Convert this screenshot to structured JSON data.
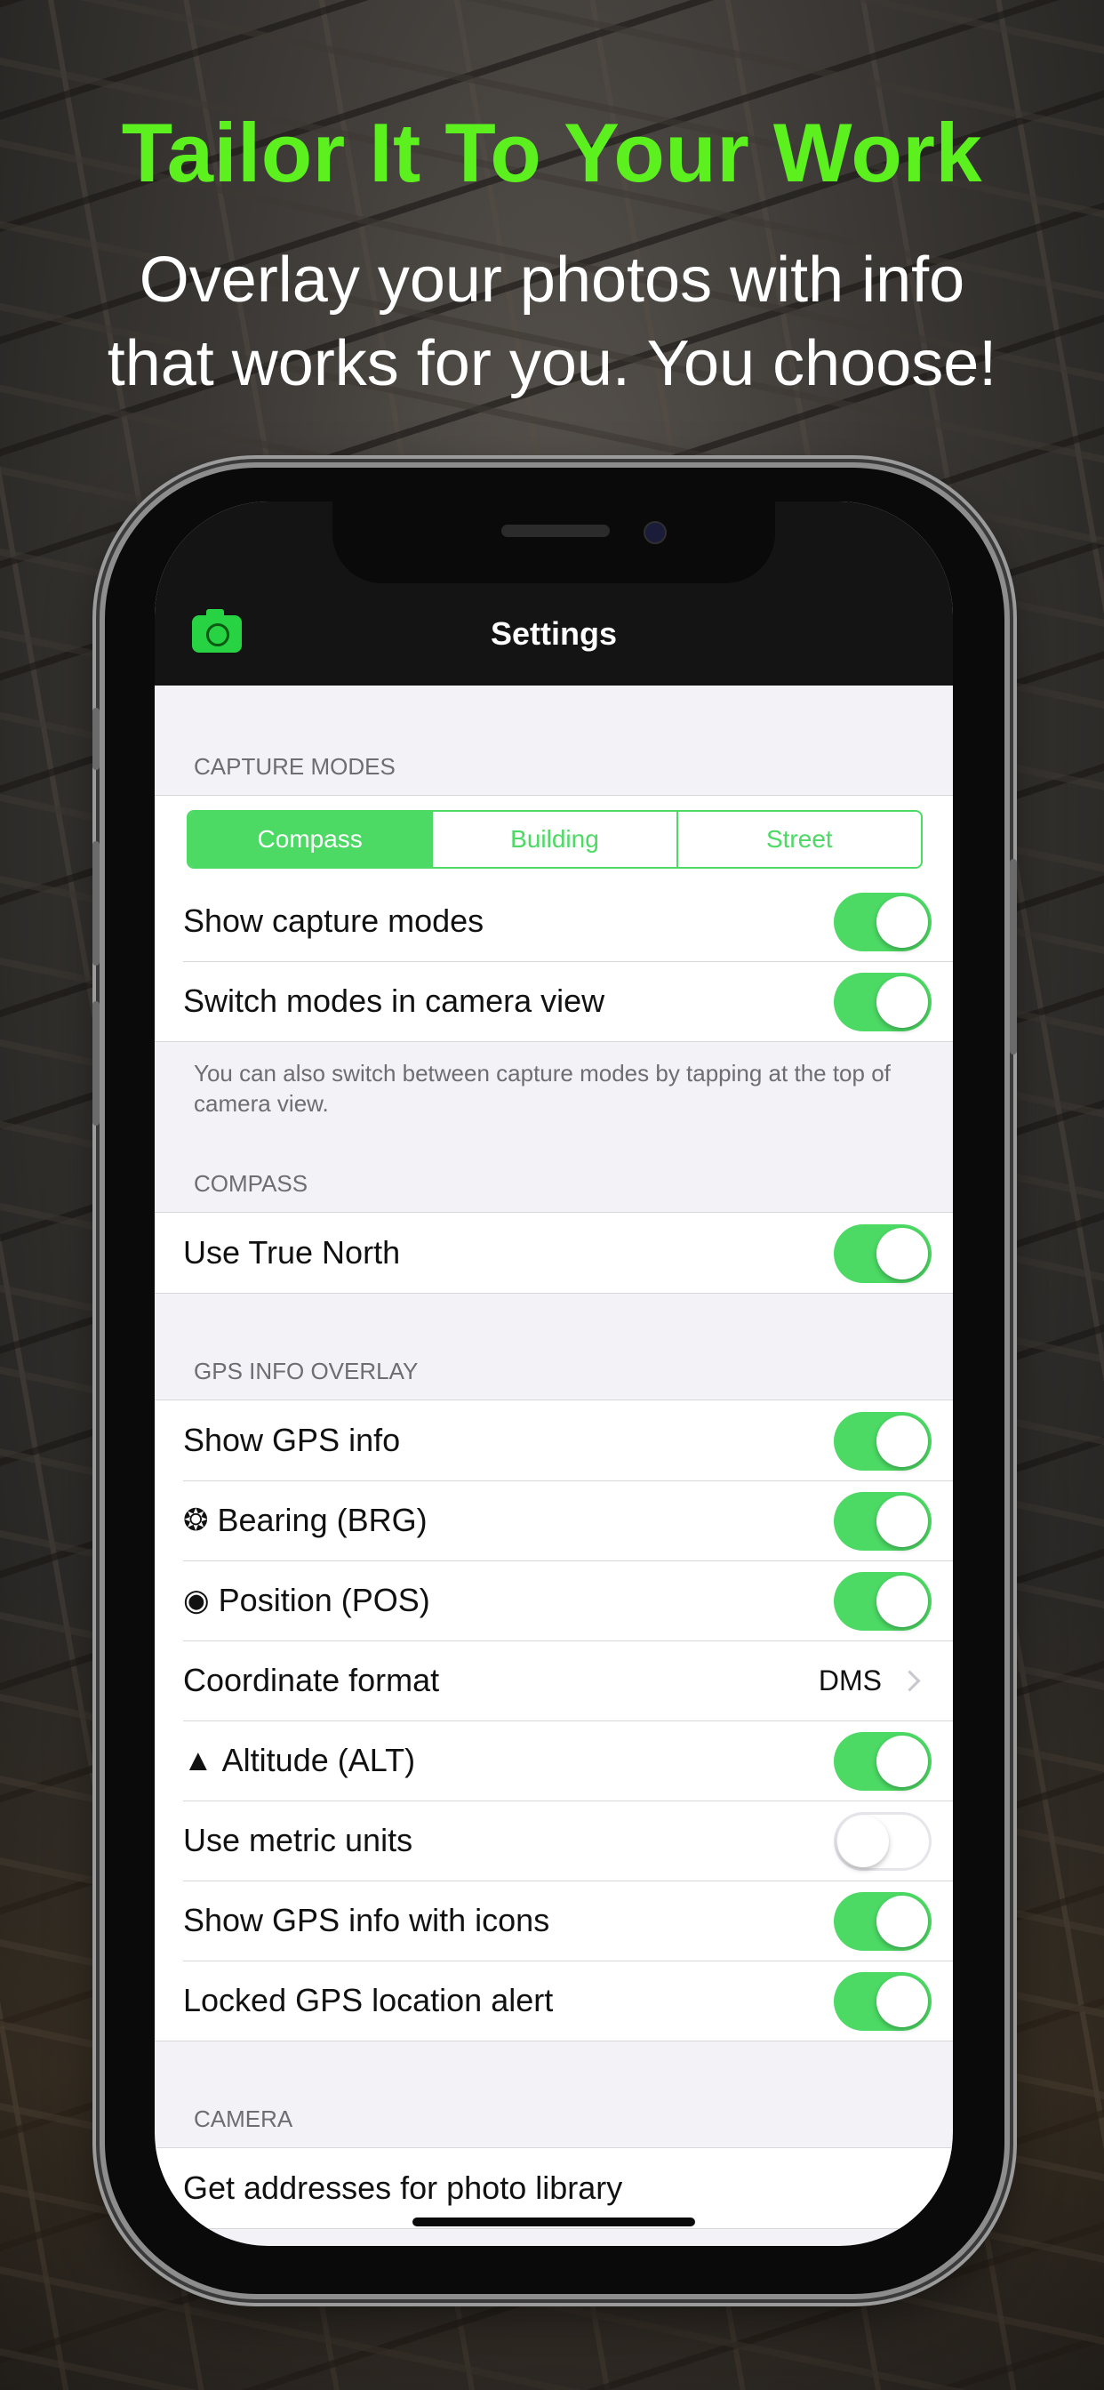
{
  "promo": {
    "headline": "Tailor It To Your Work",
    "subhead_line1": "Overlay your photos with info",
    "subhead_line2": "that works for you. You choose!"
  },
  "colors": {
    "accent_green": "#5df01f",
    "ios_green": "#4cd964",
    "nav_bg": "#141414"
  },
  "navbar": {
    "title": "Settings",
    "left_icon": "camera-icon"
  },
  "capture_modes": {
    "header": "CAPTURE MODES",
    "segments": [
      "Compass",
      "Building",
      "Street"
    ],
    "selected": "Compass",
    "rows": [
      {
        "label": "Show capture modes",
        "on": true
      },
      {
        "label": "Switch modes in camera view",
        "on": true
      }
    ],
    "footer": "You can also switch between capture modes by tapping at the top of camera view."
  },
  "compass": {
    "header": "COMPASS",
    "rows": [
      {
        "label": "Use True North",
        "on": true
      }
    ]
  },
  "gps": {
    "header": "GPS INFO OVERLAY",
    "rows": [
      {
        "label": "Show GPS info",
        "on": true
      },
      {
        "icon": "❂",
        "label": "Bearing (BRG)",
        "on": true
      },
      {
        "icon": "◉",
        "label": "Position (POS)",
        "on": true
      },
      {
        "label": "Coordinate format",
        "detail": "DMS"
      },
      {
        "icon": "▲",
        "label": "Altitude (ALT)",
        "on": true
      },
      {
        "label": "Use metric units",
        "on": false
      },
      {
        "label": "Show GPS info with icons",
        "on": true
      },
      {
        "label": "Locked GPS location alert",
        "on": true
      }
    ]
  },
  "camera": {
    "header": "CAMERA",
    "rows": [
      {
        "label": "Get addresses for photo library"
      }
    ]
  }
}
